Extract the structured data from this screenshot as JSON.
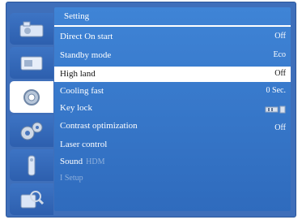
{
  "menu": {
    "title": "Setting",
    "sidebar": [
      {
        "icon": "picture-icon",
        "active": false
      },
      {
        "icon": "screen-icon",
        "active": false
      },
      {
        "icon": "gear-icon",
        "active": true
      },
      {
        "icon": "expanded-setting-gears-icon",
        "active": false
      },
      {
        "icon": "remote-control-icon",
        "active": false
      },
      {
        "icon": "info-magnifier-icon",
        "active": false
      }
    ],
    "rows": [
      {
        "label": "Direct On start",
        "value": "Off"
      },
      {
        "label": "Standby mode",
        "value": "Eco"
      },
      {
        "label": "High land",
        "value": "Off"
      },
      {
        "label": "Cooling fast",
        "value": "0 Sec."
      },
      {
        "label": "Key lock",
        "value_icon": "key-lock-icon"
      },
      {
        "label": "Contrast optimization",
        "value": "Off"
      },
      {
        "label": "Laser control"
      },
      {
        "label": "Sound",
        "extra": "HDM"
      },
      {
        "label": "I Setup"
      }
    ]
  }
}
